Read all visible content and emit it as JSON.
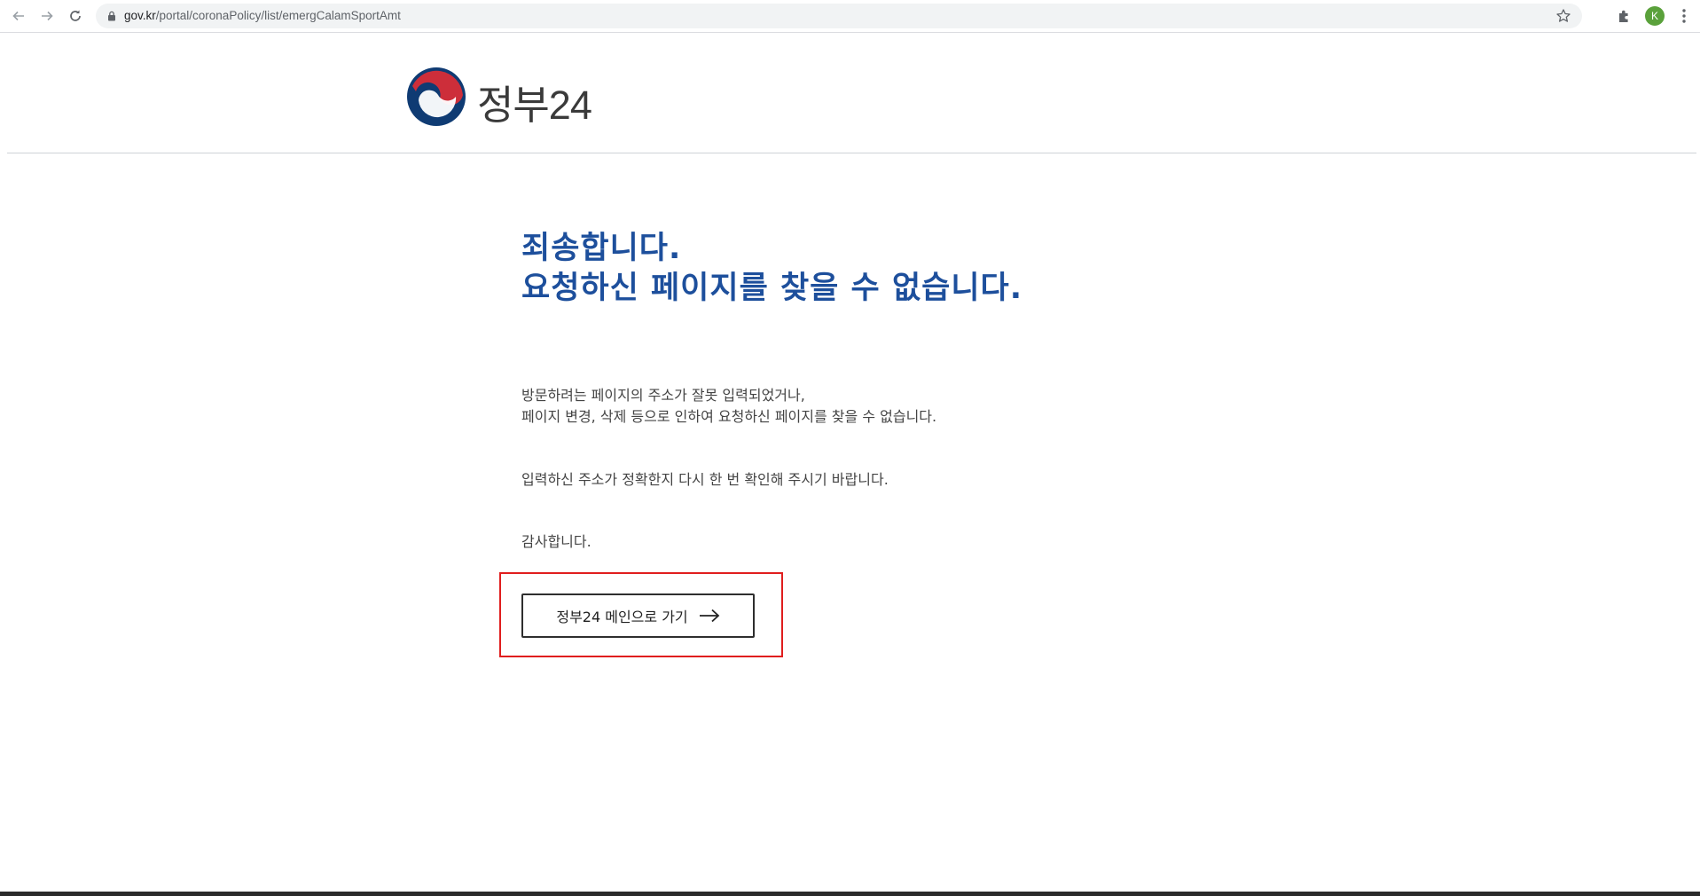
{
  "browser": {
    "url_host": "gov.kr",
    "url_path": "/portal/coronaPolicy/list/emergCalamSportAmt",
    "avatar_letter": "K"
  },
  "header": {
    "logo_text": "정부24",
    "logo_colors": {
      "red": "#cd2e3a",
      "blue": "#0f3b73"
    }
  },
  "error": {
    "title_line1": "죄송합니다.",
    "title_line2": "요청하신 페이지를 찾을 수 없습니다.",
    "desc_line1": "방문하려는 페이지의 주소가 잘못 입력되었거나,",
    "desc_line2": "페이지 변경, 삭제 등으로 인하여 요청하신 페이지를 찾을 수 없습니다.",
    "check_text": "입력하신 주소가 정확한지 다시 한 번 확인해 주시기 바랍니다.",
    "thanks": "감사합니다.",
    "button_label": "정부24 메인으로 가기"
  },
  "colors": {
    "title": "#1d4f9c",
    "highlight": "#e01e1e"
  }
}
